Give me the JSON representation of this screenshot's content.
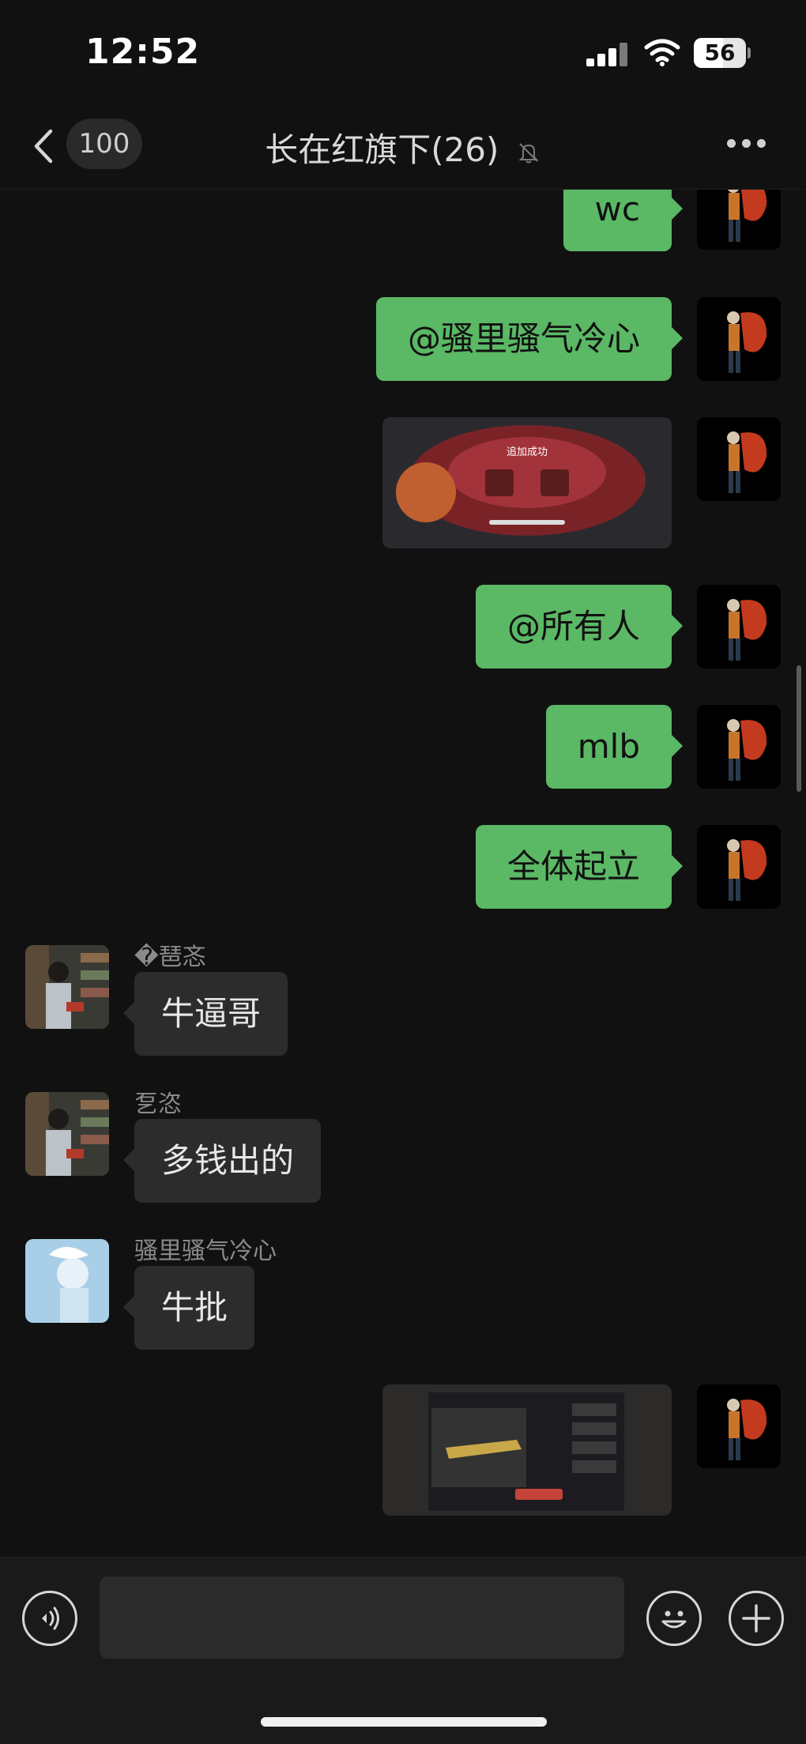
{
  "status_bar": {
    "time": "12:52",
    "battery": "56",
    "battery_level": 0.56
  },
  "nav": {
    "unread_count": "100",
    "chat_title": "长在红旗下(26)"
  },
  "messages": [
    {
      "side": "me",
      "type": "text",
      "text": "wc"
    },
    {
      "side": "me",
      "type": "text",
      "text": "@骚里骚气冷心"
    },
    {
      "side": "me",
      "type": "image",
      "caption": "追加成功"
    },
    {
      "side": "me",
      "type": "text",
      "text": "@所有人"
    },
    {
      "side": "me",
      "type": "text",
      "text": "mlb"
    },
    {
      "side": "me",
      "type": "text",
      "text": "全体起立"
    },
    {
      "side": "other",
      "type": "text",
      "sender": "�琶忞",
      "text": "牛逼哥"
    },
    {
      "side": "other",
      "type": "text",
      "sender": "乭恣",
      "text": "多钱出的"
    },
    {
      "side": "other",
      "type": "text",
      "sender": "骚里骚气冷心",
      "text": "牛批"
    },
    {
      "side": "me",
      "type": "image",
      "caption": ""
    }
  ],
  "colors": {
    "background": "#111111",
    "my_bubble": "#5bb865",
    "other_bubble": "#2c2c2c"
  },
  "icons": [
    "back-icon",
    "mute-icon",
    "more-icon",
    "voice-icon",
    "emoji-icon",
    "plus-icon"
  ]
}
